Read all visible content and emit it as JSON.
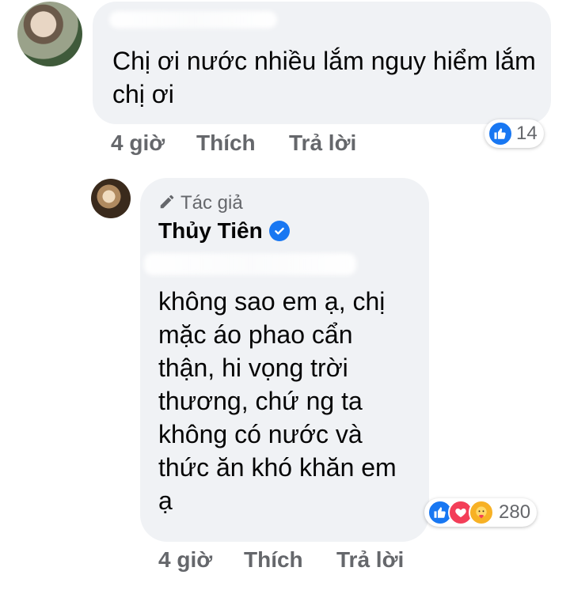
{
  "comment1": {
    "avatar_icon": "user-avatar-icon",
    "text": "Chị ơi nước nhiều lắm nguy hiểm lắm chị ơi",
    "time": "4 giờ",
    "like_label": "Thích",
    "reply_label": "Trả lời",
    "reactions": {
      "icons": [
        "like-icon"
      ],
      "count": "14"
    }
  },
  "comment2": {
    "avatar_icon": "author-avatar-icon",
    "badge_label": "Tác giả",
    "badge_icon": "pencil-icon",
    "author_name": "Thủy Tiên",
    "verified_icon": "verified-check-icon",
    "text": "không sao em ạ, chị mặc áo phao cẩn thận, hi vọng trời thương, chứ ng ta không có nước và thức ăn khó khăn em ạ",
    "time": "4 giờ",
    "like_label": "Thích",
    "reply_label": "Trả lời",
    "reactions": {
      "icons": [
        "like-icon",
        "love-icon",
        "care-icon"
      ],
      "count": "280"
    }
  },
  "colors": {
    "bubble_bg": "#f0f2f5",
    "meta_text": "#65676b",
    "like_blue": "#1877f2",
    "love_red": "#f33e58",
    "care_yellow": "#f7b125"
  }
}
